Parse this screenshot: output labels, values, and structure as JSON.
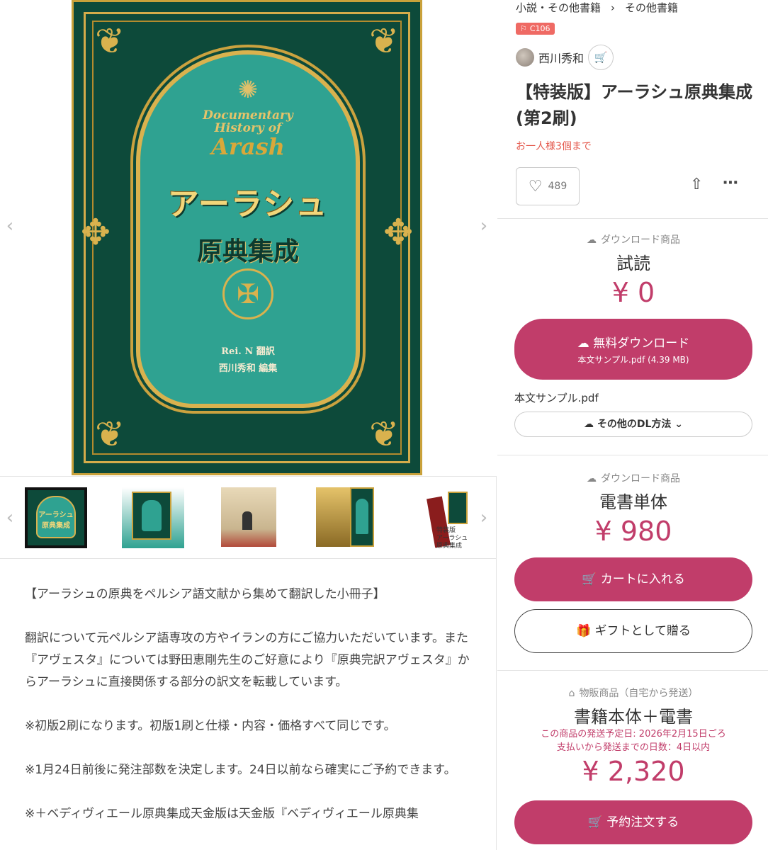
{
  "gallery": {
    "prev_arrow": "‹",
    "next_arrow": "›",
    "cover": {
      "en_line1": "Documentary",
      "en_line2": "History of",
      "en_line3": "Arash",
      "jp_title1": "アーラシュ",
      "jp_title2": "原典集成",
      "credit1": "Rei. N 翻訳",
      "credit2": "西川秀和 編集"
    },
    "thumb1_text": "アーラシュ原典集成",
    "thumb5_text1": "特装版",
    "thumb5_text2": "アーラシュ",
    "thumb5_text3": "原典集成"
  },
  "description": {
    "paragraphs": [
      "【アーラシュの原典をペルシア語文献から集めて翻訳した小冊子】",
      "翻訳について元ペルシア語専攻の方やイランの方にご協力いただいています。また『アヴェスタ』については野田恵剛先生のご好意により『原典完訳アヴェスタ』からアーラシュに直接関係する部分の訳文を転載しています。",
      "※初版2刷になります。初版1刷と仕様・内容・価格すべて同じです。",
      "※1月24日前後に発注部数を決定します。24日以前なら確実にご予約できます。",
      "※＋ベディヴィエール原典集成天金版は天金版『ベディヴィエール原典集"
    ]
  },
  "product": {
    "breadcrumb": [
      "小説・その他書籍",
      "その他書籍"
    ],
    "breadcrumb_sep": "›",
    "event_tag": "C106",
    "shop_name": "西川秀和",
    "title": "【特装版】アーラシュ原典集成(第2刷)",
    "limit": "お一人様3個まで",
    "fav_count": "489"
  },
  "offers": [
    {
      "kind": "ダウンロード商品",
      "name": "試読",
      "price": "¥ 0",
      "button_label": "無料ダウンロード",
      "button_sub": "本文サンプル.pdf (4.39 MB)",
      "file_name": "本文サンプル.pdf",
      "other_dl": "その他のDL方法"
    },
    {
      "kind": "ダウンロード商品",
      "name": "電書単体",
      "price": "¥ 980",
      "button_label": "カートに入れる",
      "gift_label": "ギフトとして贈る"
    },
    {
      "kind": "物販商品（自宅から発送）",
      "name": "書籍本体＋電書",
      "ship_date": "この商品の発送予定日: 2026年2月15日ごろ",
      "ship_days": "支払いから発送までの日数：4日以内",
      "price": "¥ 2,320",
      "button_label": "予約注文する"
    }
  ],
  "colors": {
    "accent": "#c13d6a",
    "warning": "#e4584c",
    "tag": "#ef6a64",
    "cover_green": "#0d4a3a",
    "cover_teal": "#2fa291",
    "cover_gold": "#d9b24e"
  }
}
